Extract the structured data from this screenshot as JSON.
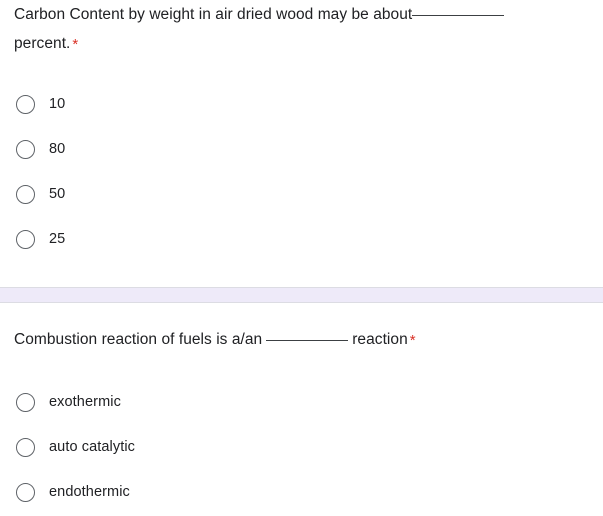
{
  "form": {
    "accent_required_color": "#d93025",
    "divider_color": "#eeeaf9",
    "divider_border_color": "#dcdce3",
    "text_color": "#202124",
    "radio_border_color": "#5f6368",
    "background_color": "#ffffff"
  },
  "questions": [
    {
      "id": "q1",
      "line1_before_blank": "Carbon Content by weight in air dried wood may be about",
      "line1_after_blank": "",
      "line2": "percent.",
      "required_marker": "*",
      "options": [
        {
          "label": "10",
          "selected": false
        },
        {
          "label": "80",
          "selected": false
        },
        {
          "label": "50",
          "selected": false
        },
        {
          "label": "25",
          "selected": false
        }
      ]
    },
    {
      "id": "q2",
      "line1_before_blank": "Combustion reaction of fuels is a/an",
      "line1_after_blank": "reaction",
      "line2": "",
      "required_marker": "*",
      "options": [
        {
          "label": "exothermic",
          "selected": false
        },
        {
          "label": "auto catalytic",
          "selected": false
        },
        {
          "label": "endothermic",
          "selected": false
        }
      ]
    }
  ]
}
